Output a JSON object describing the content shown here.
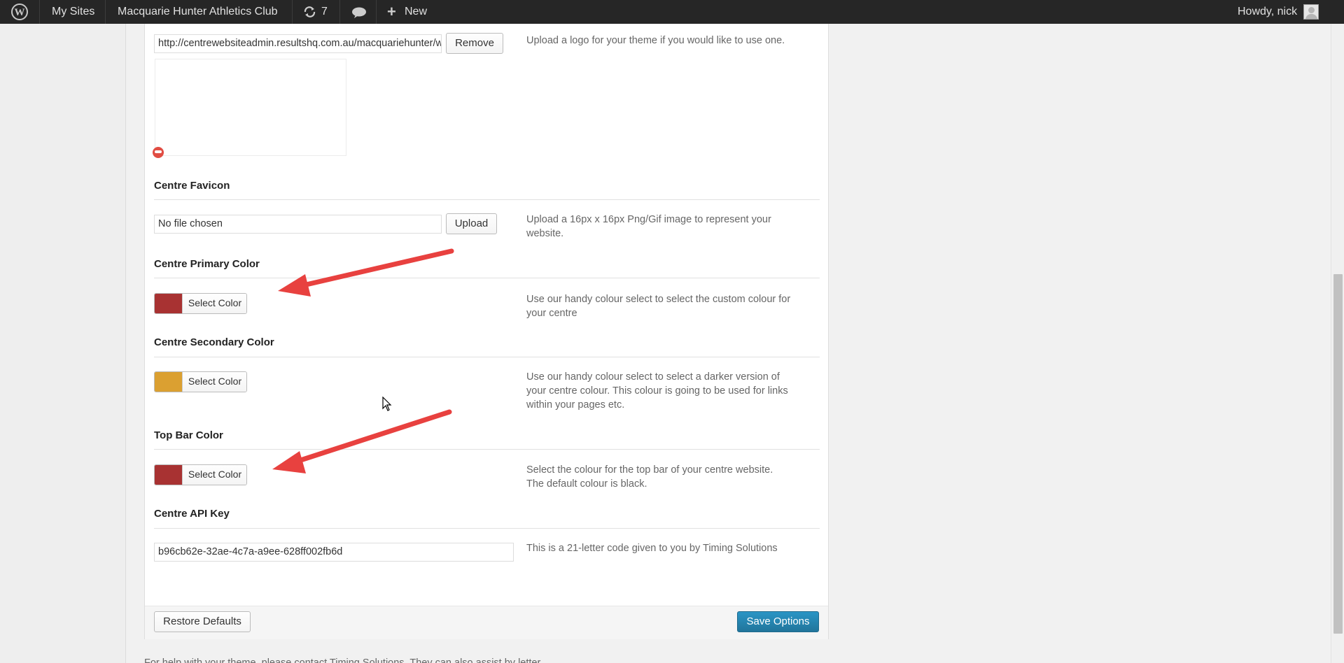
{
  "admin_bar": {
    "my_sites": "My Sites",
    "site_name": "Macquarie Hunter Athletics Club",
    "updates_count": "7",
    "new_label": "New",
    "greeting": "Howdy, nick"
  },
  "logo": {
    "url_value": "http://centrewebsiteadmin.resultshq.com.au/macquariehunter/w",
    "remove_label": "Remove",
    "description": "Upload a logo for your theme if you would like to use one."
  },
  "favicon": {
    "label": "Centre Favicon",
    "input_value": "No file chosen",
    "upload_label": "Upload",
    "description": "Upload a 16px x 16px Png/Gif image to represent your website."
  },
  "primary_color": {
    "label": "Centre Primary Color",
    "button_label": "Select Color",
    "swatch": "#a83232",
    "description": "Use our handy colour select to select the custom colour for your centre"
  },
  "secondary_color": {
    "label": "Centre Secondary Color",
    "button_label": "Select Color",
    "swatch": "#dba031",
    "description": "Use our handy colour select to select a darker version of your centre colour. This colour is going to be used for links within your pages etc."
  },
  "top_bar_color": {
    "label": "Top Bar Color",
    "button_label": "Select Color",
    "swatch": "#a83232",
    "description": "Select the colour for the top bar of your centre website. The default colour is black."
  },
  "api_key": {
    "label": "Centre API Key",
    "value": "b96cb62e-32ae-4c7a-a9ee-628ff002fb6d",
    "description": "This is a 21-letter code given to you by Timing Solutions"
  },
  "actions": {
    "restore_label": "Restore Defaults",
    "save_label": "Save Options"
  },
  "bottom_text": "For help with your theme, please contact Timing Solutions. They can also assist by letter...",
  "colors": {
    "accent": "#21759b",
    "annotation_arrow": "#e8413f",
    "admin_bar": "#262626"
  },
  "icons": [
    "wordpress-logo-icon",
    "updates-icon",
    "comments-icon",
    "plus-icon",
    "avatar"
  ]
}
